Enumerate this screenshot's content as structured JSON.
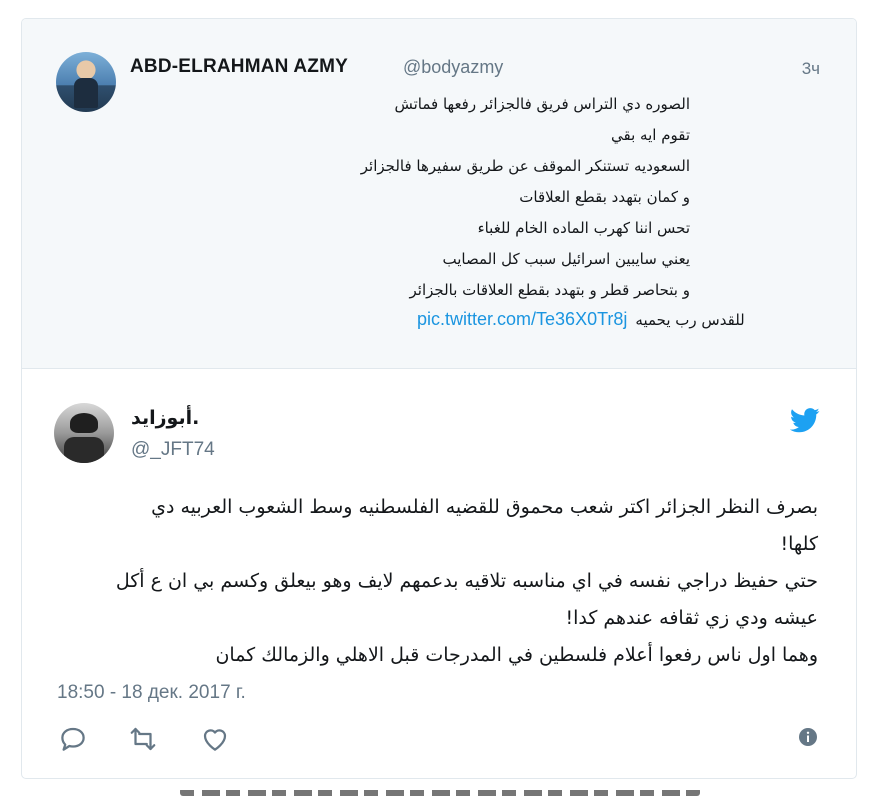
{
  "quoted_tweet": {
    "name": "ABD-ELRAHMAN AZMY",
    "handle": "@bodyazmy",
    "time": "3ч",
    "lines": [
      "الصوره دي التراس فريق فالجزائر رفعها فماتش",
      "تقوم ايه بقي",
      "السعوديه تستنكر الموقف عن طريق سفيرها فالجزائر",
      "و كمان بتهدد بقطع العلاقات",
      "تحس اننا كهرب الماده الخام للغباء",
      "يعني سايبين اسرائيل سبب كل المصايب",
      "و بتحاصر قطر و بتهدد بقطع العلاقات بالجزائر"
    ],
    "last_line": "للقدس رب يحميه",
    "link": "pic.twitter.com/Te36X0Tr8j"
  },
  "tweet": {
    "name": "أبوزايد.",
    "handle": "@_JFT74",
    "body_lines": [
      "بصرف النظر الجزائر اكتر شعب محموق للقضيه الفلسطنيه وسط الشعوب العربيه دي",
      "كلها!",
      "حتي حفيظ دراجي نفسه في اي مناسبه تلاقيه بدعمهم لايف وهو بيعلق وكسم بي ان ع أكل",
      "عيشه ودي زي ثقافه عندهم كدا!",
      "وهما اول ناس رفعوا أعلام فلسطين في المدرجات قبل الاهلي والزمالك كمان"
    ],
    "timestamp": "18:50 - 18 дек. 2017 г."
  },
  "actions": {
    "reply_icon": "reply-icon",
    "retweet_icon": "retweet-icon",
    "like_icon": "heart-icon",
    "info_icon": "info-icon",
    "bird_icon": "twitter-bird-icon"
  },
  "colors": {
    "link": "#1b95e0",
    "muted": "#657786",
    "quoted_bg": "#f5f8fa",
    "bird": "#1da1f2"
  }
}
